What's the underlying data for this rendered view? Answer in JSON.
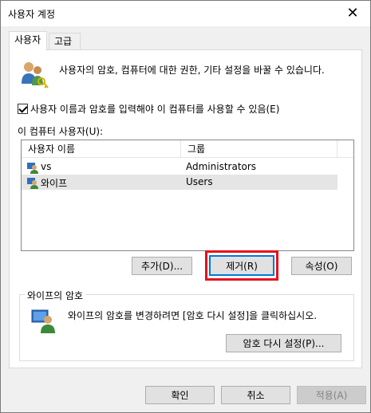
{
  "window": {
    "title": "사용자 계정",
    "close_glyph": "✕"
  },
  "tabs": [
    {
      "label": "사용자",
      "active": true
    },
    {
      "label": "고급",
      "active": false
    }
  ],
  "intro_text": "사용자의 암호, 컴퓨터에 대한 권한, 기타 설정을 바꿀 수 있습니다.",
  "require_login": {
    "label": "사용자 이름과 암호를 입력해야 이 컴퓨터를 사용할 수 있음(E)",
    "checked": true
  },
  "users_list": {
    "label": "이 컴퓨터 사용자(U):",
    "columns": [
      "사용자 이름",
      "그룹"
    ],
    "rows": [
      {
        "name": "vs",
        "group": "Administrators",
        "selected": false
      },
      {
        "name": "와이프",
        "group": "Users",
        "selected": true
      }
    ]
  },
  "list_buttons": {
    "add": "추가(D)...",
    "remove": "제거(R)",
    "properties": "속성(O)"
  },
  "password_group": {
    "title": "와이프의 암호",
    "text": "와이프의 암호를 변경하려면 [암호 다시 설정]을 클릭하십시오.",
    "reset_button": "암호 다시 설정(P)..."
  },
  "dialog_buttons": {
    "ok": "확인",
    "cancel": "취소",
    "apply": "적용(A)"
  },
  "colors": {
    "highlight": "#e8101e",
    "focus": "#0078d7"
  }
}
